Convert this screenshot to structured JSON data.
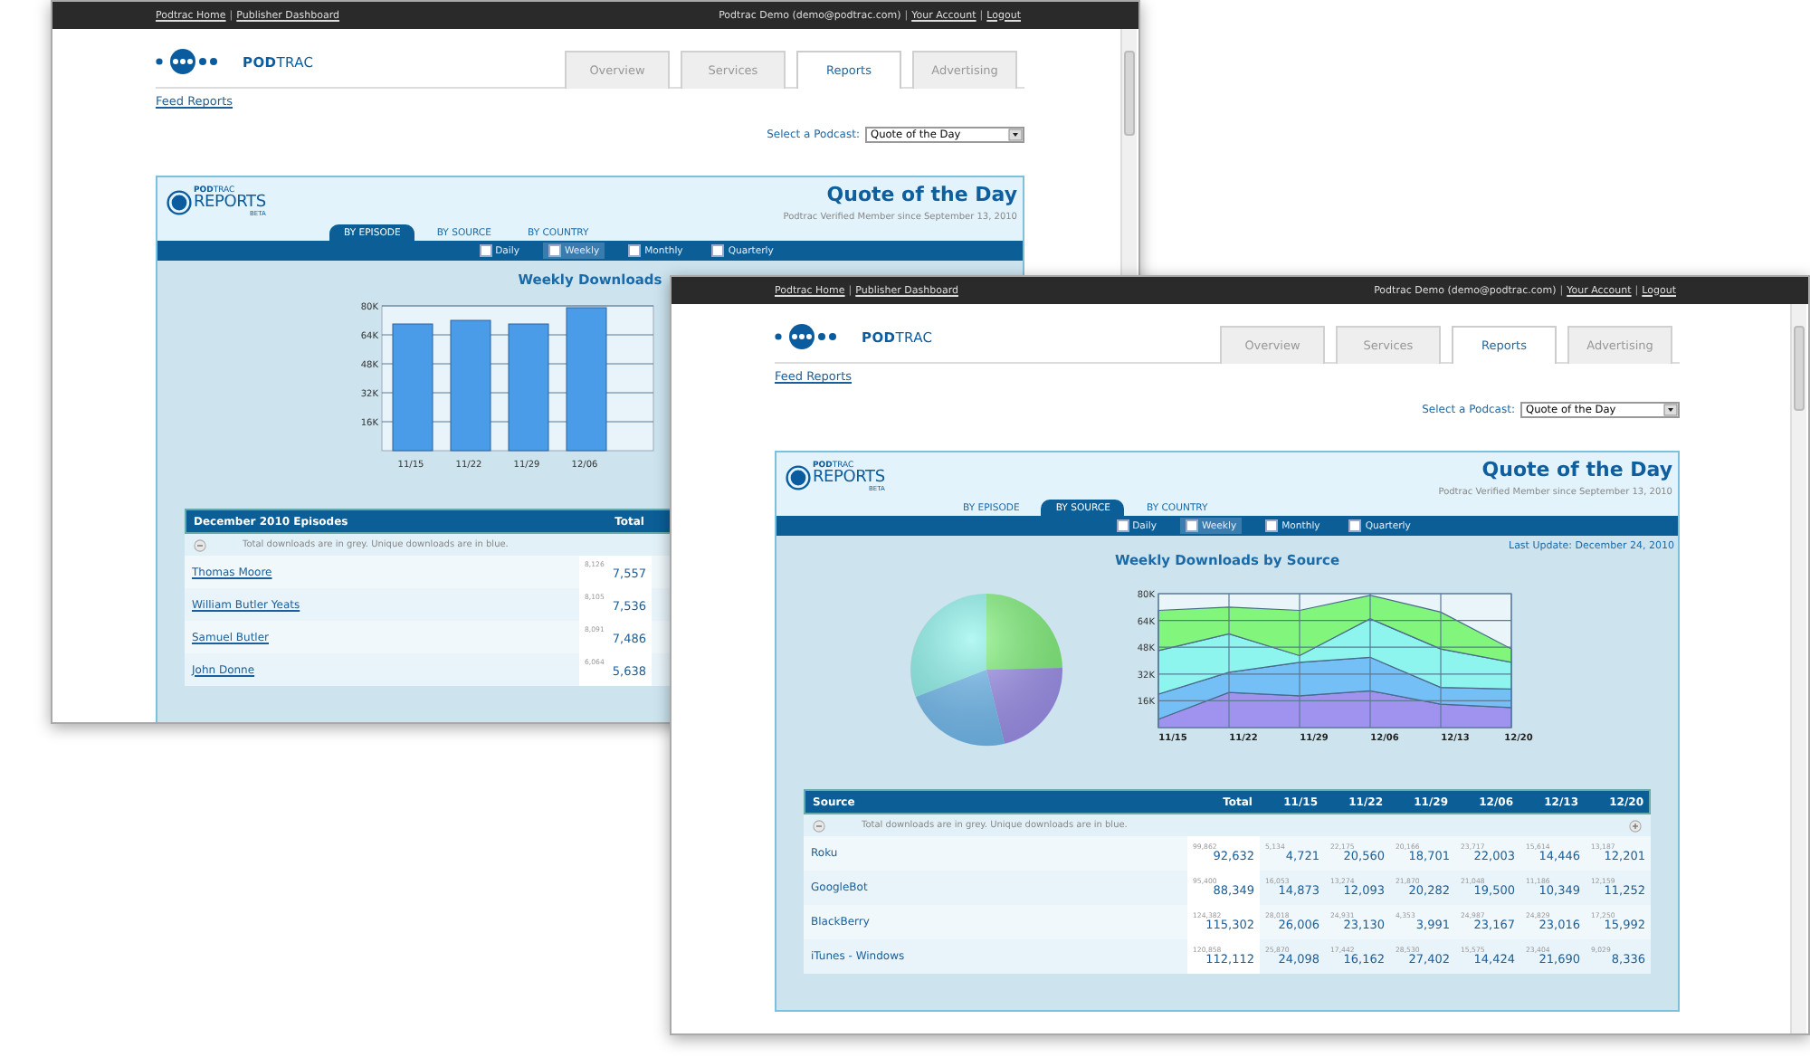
{
  "windows": [
    {
      "top_links": [
        "Podtrac Home",
        "Publisher Dashboard"
      ],
      "separator": "|",
      "user": "Podtrac Demo (demo@podtrac.com)",
      "account_links": [
        "Your Account",
        "Logout"
      ],
      "logo_text": "**POD**TRAC",
      "tabs": [
        {
          "label": "Overview",
          "selected": false
        },
        {
          "label": "Services",
          "selected": false
        },
        {
          "label": "Reports",
          "selected": true
        },
        {
          "label": "Advertising",
          "selected": false
        }
      ],
      "breadcrumb": "Feed Reports",
      "podcast_label": "Select a Podcast:",
      "podcast_value": "Quote of the Day",
      "report": {
        "logo_small": "**POD**TRAC",
        "logo_big": "REPORTS",
        "logo_tag": "BETA",
        "title": "Quote of the Day",
        "member_note": "Podtrac Verified Member since September 13, 2010",
        "views": [
          {
            "label": "BY EPISODE",
            "selected": true
          },
          {
            "label": "BY SOURCE",
            "selected": false
          },
          {
            "label": "BY COUNTRY",
            "selected": false
          }
        ],
        "periods": [
          {
            "label": "Daily",
            "selected": false
          },
          {
            "label": "Weekly",
            "selected": true
          },
          {
            "label": "Monthly",
            "selected": false
          },
          {
            "label": "Quarterly",
            "selected": false
          }
        ],
        "chart_title": "Weekly Downloads",
        "charts": [
          {
            "chart_data": {
              "type": "bar",
              "categories": [
                "11/15",
                "11/22",
                "11/29",
                "12/06"
              ],
              "series": [
                {
                  "color": "#4a9be8",
                  "values": [
                    70,
                    72,
                    70,
                    79
                  ]
                }
              ],
              "ylim": [
                0,
                80
              ],
              "grid": true,
              "yticks": [
                {
                  "value": 16,
                  "label": "16K"
                },
                {
                  "value": 32,
                  "label": "32K"
                },
                {
                  "value": 48,
                  "label": "48K"
                },
                {
                  "value": 64,
                  "label": "64K"
                },
                {
                  "value": 80,
                  "label": "80K"
                }
              ]
            }
          }
        ],
        "table": {
          "name_heading": "December 2010 Episodes",
          "columns": [
            "Total"
          ],
          "note": "Total downloads are in grey. Unique downloads are in blue.",
          "rows": [
            {
              "name": "Thomas Moore",
              "cells": [
                {
                  "total": "8,126",
                  "unique": "7,557"
                }
              ]
            },
            {
              "name": "William Butler Yeats",
              "cells": [
                {
                  "total": "8,105",
                  "unique": "7,536"
                }
              ]
            },
            {
              "name": "Samuel Butler",
              "cells": [
                {
                  "total": "8,091",
                  "unique": "7,486"
                }
              ]
            },
            {
              "name": "John Donne",
              "cells": [
                {
                  "total": "6,064",
                  "unique": "5,638"
                }
              ]
            }
          ]
        }
      }
    },
    {
      "top_links": [
        "Podtrac Home",
        "Publisher Dashboard"
      ],
      "separator": "|",
      "user": "Podtrac Demo (demo@podtrac.com)",
      "account_links": [
        "Your Account",
        "Logout"
      ],
      "logo_text": "**POD**TRAC",
      "tabs": [
        {
          "label": "Overview",
          "selected": false
        },
        {
          "label": "Services",
          "selected": false
        },
        {
          "label": "Reports",
          "selected": true
        },
        {
          "label": "Advertising",
          "selected": false
        }
      ],
      "breadcrumb": "Feed Reports",
      "podcast_label": "Select a Podcast:",
      "podcast_value": "Quote of the Day",
      "report": {
        "logo_small": "**POD**TRAC",
        "logo_big": "REPORTS",
        "logo_tag": "BETA",
        "title": "Quote of the Day",
        "member_note": "Podtrac Verified Member since September 13, 2010",
        "views": [
          {
            "label": "BY EPISODE",
            "selected": false
          },
          {
            "label": "BY SOURCE",
            "selected": true
          },
          {
            "label": "BY COUNTRY",
            "selected": false
          }
        ],
        "periods": [
          {
            "label": "Daily",
            "selected": false
          },
          {
            "label": "Weekly",
            "selected": true
          },
          {
            "label": "Monthly",
            "selected": false
          },
          {
            "label": "Quarterly",
            "selected": false
          }
        ],
        "last_update": "Last Update: December 24, 2010",
        "chart_title": "Weekly Downloads by Source",
        "charts": [
          {
            "kind": "pie"
          },
          {
            "chart_data": {
              "type": "area",
              "stacked": true,
              "grid": true,
              "categories": [
                "11/15",
                "11/22",
                "11/29",
                "12/06",
                "12/13",
                "12/20"
              ],
              "ylim": [
                0,
                80
              ],
              "yticks": [
                {
                  "value": 16,
                  "label": "16K"
                },
                {
                  "value": 32,
                  "label": "32K"
                },
                {
                  "value": 48,
                  "label": "48K"
                },
                {
                  "value": 64,
                  "label": "64K"
                },
                {
                  "value": 80,
                  "label": "80K"
                }
              ],
              "series": [
                {
                  "color": "#a093f0",
                  "values": [
                    5,
                    21,
                    19,
                    22,
                    14,
                    12
                  ]
                },
                {
                  "color": "#74bff5",
                  "values": [
                    15,
                    12,
                    20,
                    20,
                    10,
                    11
                  ]
                },
                {
                  "color": "#8ef5ee",
                  "values": [
                    26,
                    23,
                    4,
                    23,
                    23,
                    16
                  ]
                },
                {
                  "color": "#82f57c",
                  "values": [
                    24,
                    16,
                    27,
                    14,
                    22,
                    8
                  ]
                }
              ]
            }
          }
        ],
        "table": {
          "name_heading": "Source",
          "columns": [
            "Total",
            "11/15",
            "11/22",
            "11/29",
            "12/06",
            "12/13",
            "12/20"
          ],
          "note": "Total downloads are in grey. Unique downloads are in blue.",
          "expand_control": true,
          "rows": [
            {
              "name": "Roku",
              "cells": [
                {
                  "total": "99,862",
                  "unique": "92,632"
                },
                {
                  "total": "5,134",
                  "unique": "4,721"
                },
                {
                  "total": "22,175",
                  "unique": "20,560"
                },
                {
                  "total": "20,166",
                  "unique": "18,701"
                },
                {
                  "total": "23,717",
                  "unique": "22,003"
                },
                {
                  "total": "15,614",
                  "unique": "14,446"
                },
                {
                  "total": "13,187",
                  "unique": "12,201"
                }
              ]
            },
            {
              "name": "GoogleBot",
              "cells": [
                {
                  "total": "95,400",
                  "unique": "88,349"
                },
                {
                  "total": "16,053",
                  "unique": "14,873"
                },
                {
                  "total": "13,274",
                  "unique": "12,093"
                },
                {
                  "total": "21,870",
                  "unique": "20,282"
                },
                {
                  "total": "21,048",
                  "unique": "19,500"
                },
                {
                  "total": "11,186",
                  "unique": "10,349"
                },
                {
                  "total": "12,159",
                  "unique": "11,252"
                }
              ]
            },
            {
              "name": "BlackBerry",
              "cells": [
                {
                  "total": "124,382",
                  "unique": "115,302"
                },
                {
                  "total": "28,018",
                  "unique": "26,006"
                },
                {
                  "total": "24,931",
                  "unique": "23,130"
                },
                {
                  "total": "4,353",
                  "unique": "3,991"
                },
                {
                  "total": "24,987",
                  "unique": "23,167"
                },
                {
                  "total": "24,829",
                  "unique": "23,016"
                },
                {
                  "total": "17,250",
                  "unique": "15,992"
                }
              ]
            },
            {
              "name": "iTunes - Windows",
              "cells": [
                {
                  "total": "120,858",
                  "unique": "112,112"
                },
                {
                  "total": "25,870",
                  "unique": "24,098"
                },
                {
                  "total": "17,442",
                  "unique": "16,162"
                },
                {
                  "total": "28,530",
                  "unique": "27,402"
                },
                {
                  "total": "15,575",
                  "unique": "14,424"
                },
                {
                  "total": "23,404",
                  "unique": "21,690"
                },
                {
                  "total": "9,029",
                  "unique": "8,336"
                }
              ]
            }
          ]
        }
      }
    }
  ]
}
